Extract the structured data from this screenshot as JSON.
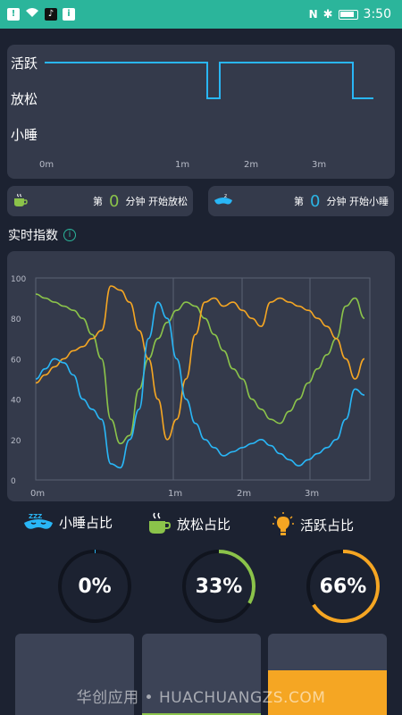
{
  "status_bar": {
    "time": "3:50",
    "color": "#2bb59b"
  },
  "state_chart": {
    "labels": [
      "活跃",
      "放松",
      "小睡"
    ],
    "x_ticks": [
      "0m",
      "1m",
      "2m",
      "3m"
    ]
  },
  "info_cards": [
    {
      "prefix": "第",
      "value": "0",
      "suffix": "分钟 开始放松",
      "icon": "teacup-icon"
    },
    {
      "prefix": "第",
      "value": "0",
      "suffix": "分钟 开始小睡",
      "icon": "sleep-mask-icon"
    }
  ],
  "section_title": "实时指数",
  "chart_data": {
    "type": "line",
    "x": [
      "0m",
      "1m",
      "2m",
      "3m"
    ],
    "ylim": [
      0,
      100
    ],
    "y_ticks": [
      "100",
      "80",
      "60",
      "40",
      "20",
      "0"
    ],
    "x_ticks": [
      "0m",
      "1m",
      "2m",
      "3m"
    ],
    "series": [
      {
        "color": "#8bc34a",
        "values": [
          92,
          90,
          88,
          86,
          84,
          80,
          72,
          60,
          30,
          18,
          22,
          45,
          60,
          70,
          78,
          84,
          88,
          86,
          80,
          72,
          64,
          55,
          50,
          40,
          35,
          30,
          28,
          34,
          40,
          48,
          55,
          62,
          70,
          86,
          90,
          80
        ]
      },
      {
        "color": "#f5a623",
        "values": [
          48,
          52,
          56,
          60,
          64,
          66,
          70,
          74,
          96,
          94,
          88,
          74,
          60,
          40,
          20,
          30,
          50,
          72,
          88,
          90,
          86,
          88,
          84,
          80,
          76,
          88,
          90,
          88,
          86,
          84,
          80,
          76,
          70,
          60,
          50,
          60
        ]
      },
      {
        "color": "#29b6f6",
        "values": [
          50,
          55,
          60,
          58,
          52,
          40,
          35,
          30,
          8,
          6,
          20,
          35,
          70,
          88,
          80,
          60,
          40,
          28,
          20,
          16,
          12,
          14,
          16,
          18,
          20,
          17,
          13,
          10,
          7,
          10,
          13,
          16,
          20,
          30,
          45,
          42
        ]
      }
    ]
  },
  "legend": [
    {
      "label": "小睡占比",
      "icon": "sleep-mask-icon"
    },
    {
      "label": "放松占比",
      "icon": "teacup-icon"
    },
    {
      "label": "活跃占比",
      "icon": "lightbulb-icon"
    }
  ],
  "rings": [
    {
      "value": "0%",
      "fraction": 0.0,
      "color": "#29b6f6"
    },
    {
      "value": "33%",
      "fraction": 0.33,
      "color": "#8bc34a"
    },
    {
      "value": "66%",
      "fraction": 0.66,
      "color": "#f5a623"
    }
  ],
  "bars": [
    {
      "fraction": 0.0,
      "color": "#29b6f6"
    },
    {
      "fraction": 0.02,
      "color": "#8bc34a"
    },
    {
      "fraction": 0.55,
      "color": "#f5a623"
    }
  ],
  "watermark": "华创应用 • HUACHUANGZS.COM"
}
